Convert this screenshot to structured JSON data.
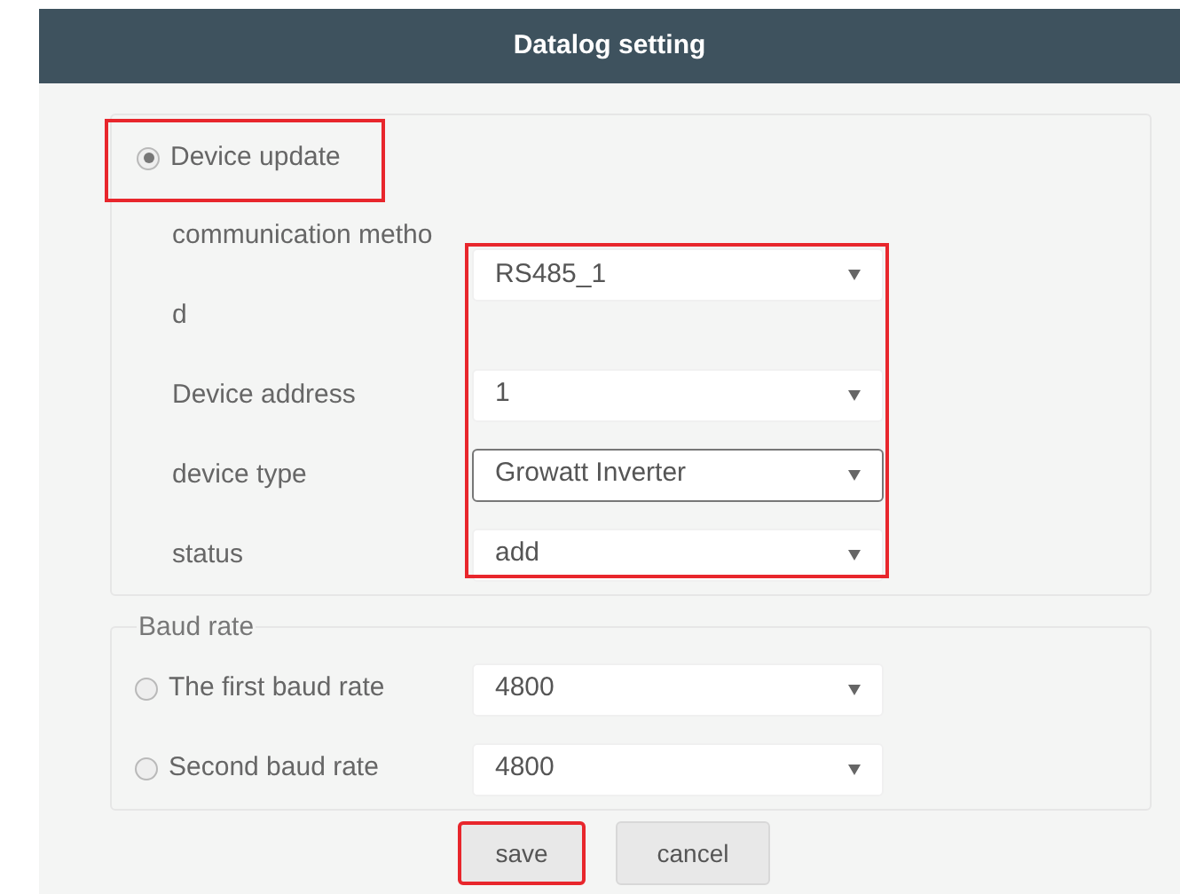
{
  "window": {
    "title": "Datalog setting"
  },
  "device_update": {
    "label": "Device update",
    "selected": true,
    "highlighted": true
  },
  "fields_highlighted": true,
  "fields": [
    {
      "label": "communication method",
      "value": "RS485_1",
      "focused": false
    },
    {
      "label": "Device address",
      "value": "1",
      "focused": false
    },
    {
      "label": "device type",
      "value": "Growatt Inverter",
      "focused": true
    },
    {
      "label": "status",
      "value": "add",
      "focused": false
    }
  ],
  "baud_rate": {
    "legend": "Baud rate",
    "options": [
      {
        "label": "The first baud rate",
        "value": "4800",
        "selected": false
      },
      {
        "label": "Second baud rate",
        "value": "4800",
        "selected": false
      }
    ]
  },
  "buttons": [
    {
      "label": "save",
      "highlighted": true
    },
    {
      "label": "cancel",
      "highlighted": false
    }
  ]
}
